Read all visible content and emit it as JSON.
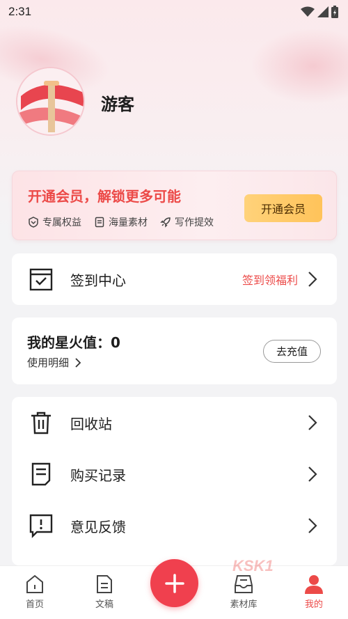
{
  "status_bar": {
    "time": "2:31"
  },
  "profile": {
    "username": "游客"
  },
  "vip": {
    "title": "开通会员，解锁更多可能",
    "features": [
      "专属权益",
      "海量素材",
      "写作提效"
    ],
    "button_label": "开通会员"
  },
  "checkin": {
    "label": "签到中心",
    "extra": "签到领福利"
  },
  "spark": {
    "title": "我的星火值：0",
    "detail_label": "使用明细",
    "recharge_label": "去充值"
  },
  "menu": {
    "items": [
      {
        "label": "回收站",
        "icon": "trash-icon"
      },
      {
        "label": "购买记录",
        "icon": "receipt-icon"
      },
      {
        "label": "意见反馈",
        "icon": "feedback-icon"
      }
    ]
  },
  "bottom_nav": {
    "items": [
      {
        "label": "首页",
        "icon": "home-icon"
      },
      {
        "label": "文稿",
        "icon": "document-icon"
      },
      {
        "label": "素材库",
        "icon": "material-library-icon"
      },
      {
        "label": "我的",
        "icon": "profile-icon",
        "active": true
      }
    ]
  },
  "watermark": "KSK1",
  "colors": {
    "accent": "#ec4a48",
    "vip_button": "#ffc35a",
    "fab": "#f0404e"
  }
}
